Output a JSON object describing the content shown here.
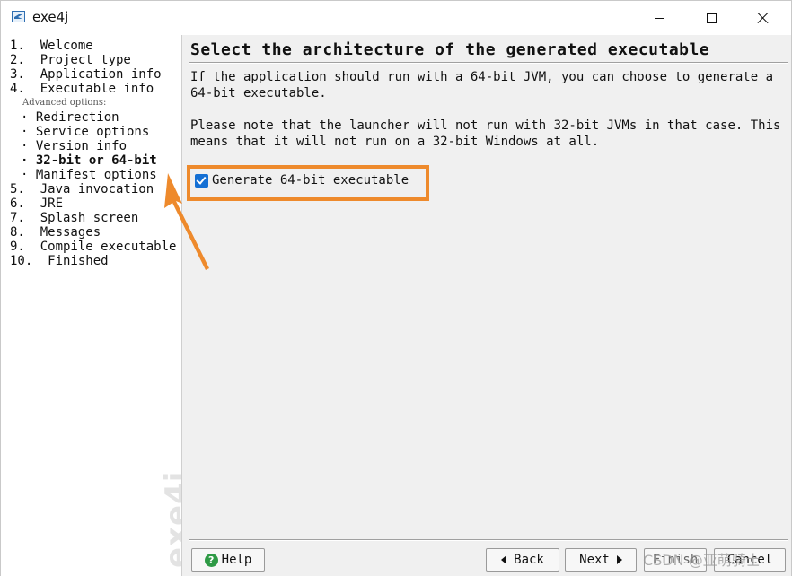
{
  "window": {
    "title": "exe4j",
    "icon": "exe4j-app-icon"
  },
  "sidebar": {
    "steps": [
      {
        "label": "1.  Welcome"
      },
      {
        "label": "2.  Project type"
      },
      {
        "label": "3.  Application info"
      },
      {
        "label": "4.  Executable info"
      }
    ],
    "advanced_label": "Advanced options:",
    "sub_steps": [
      {
        "label": "· Redirection"
      },
      {
        "label": "· Service options"
      },
      {
        "label": "· Version info"
      },
      {
        "label": "· 32-bit or 64-bit",
        "current": true
      },
      {
        "label": "· Manifest options"
      }
    ],
    "steps_after": [
      {
        "label": "5.  Java invocation"
      },
      {
        "label": "6.  JRE"
      },
      {
        "label": "7.  Splash screen"
      },
      {
        "label": "8.  Messages"
      },
      {
        "label": "9.  Compile executable"
      },
      {
        "label": "10.  Finished"
      }
    ],
    "watermark": "exe4j"
  },
  "main": {
    "title": "Select the architecture of the generated executable",
    "paragraph1_line1": "If the application should run with a 64-bit JVM, you can choose to generate a",
    "paragraph1_line2": "64-bit executable.",
    "paragraph2_line1": "Please note that the launcher will not run with 32-bit JVMs in that case. This",
    "paragraph2_line2": "means that it will not run on a 32-bit Windows at all.",
    "checkbox": {
      "label": "Generate 64-bit executable",
      "checked": true
    }
  },
  "buttons": {
    "help": "Help",
    "back": "Back",
    "next": "Next",
    "finish": "Finish",
    "cancel": "Cancel"
  },
  "overlay_text": "CSDN @亚萌骑士",
  "colors": {
    "annotation_orange": "#ee8a2c",
    "checkbox_blue": "#1570d4",
    "help_green": "#2e9a45",
    "pane_gray": "#f0f0f0"
  }
}
